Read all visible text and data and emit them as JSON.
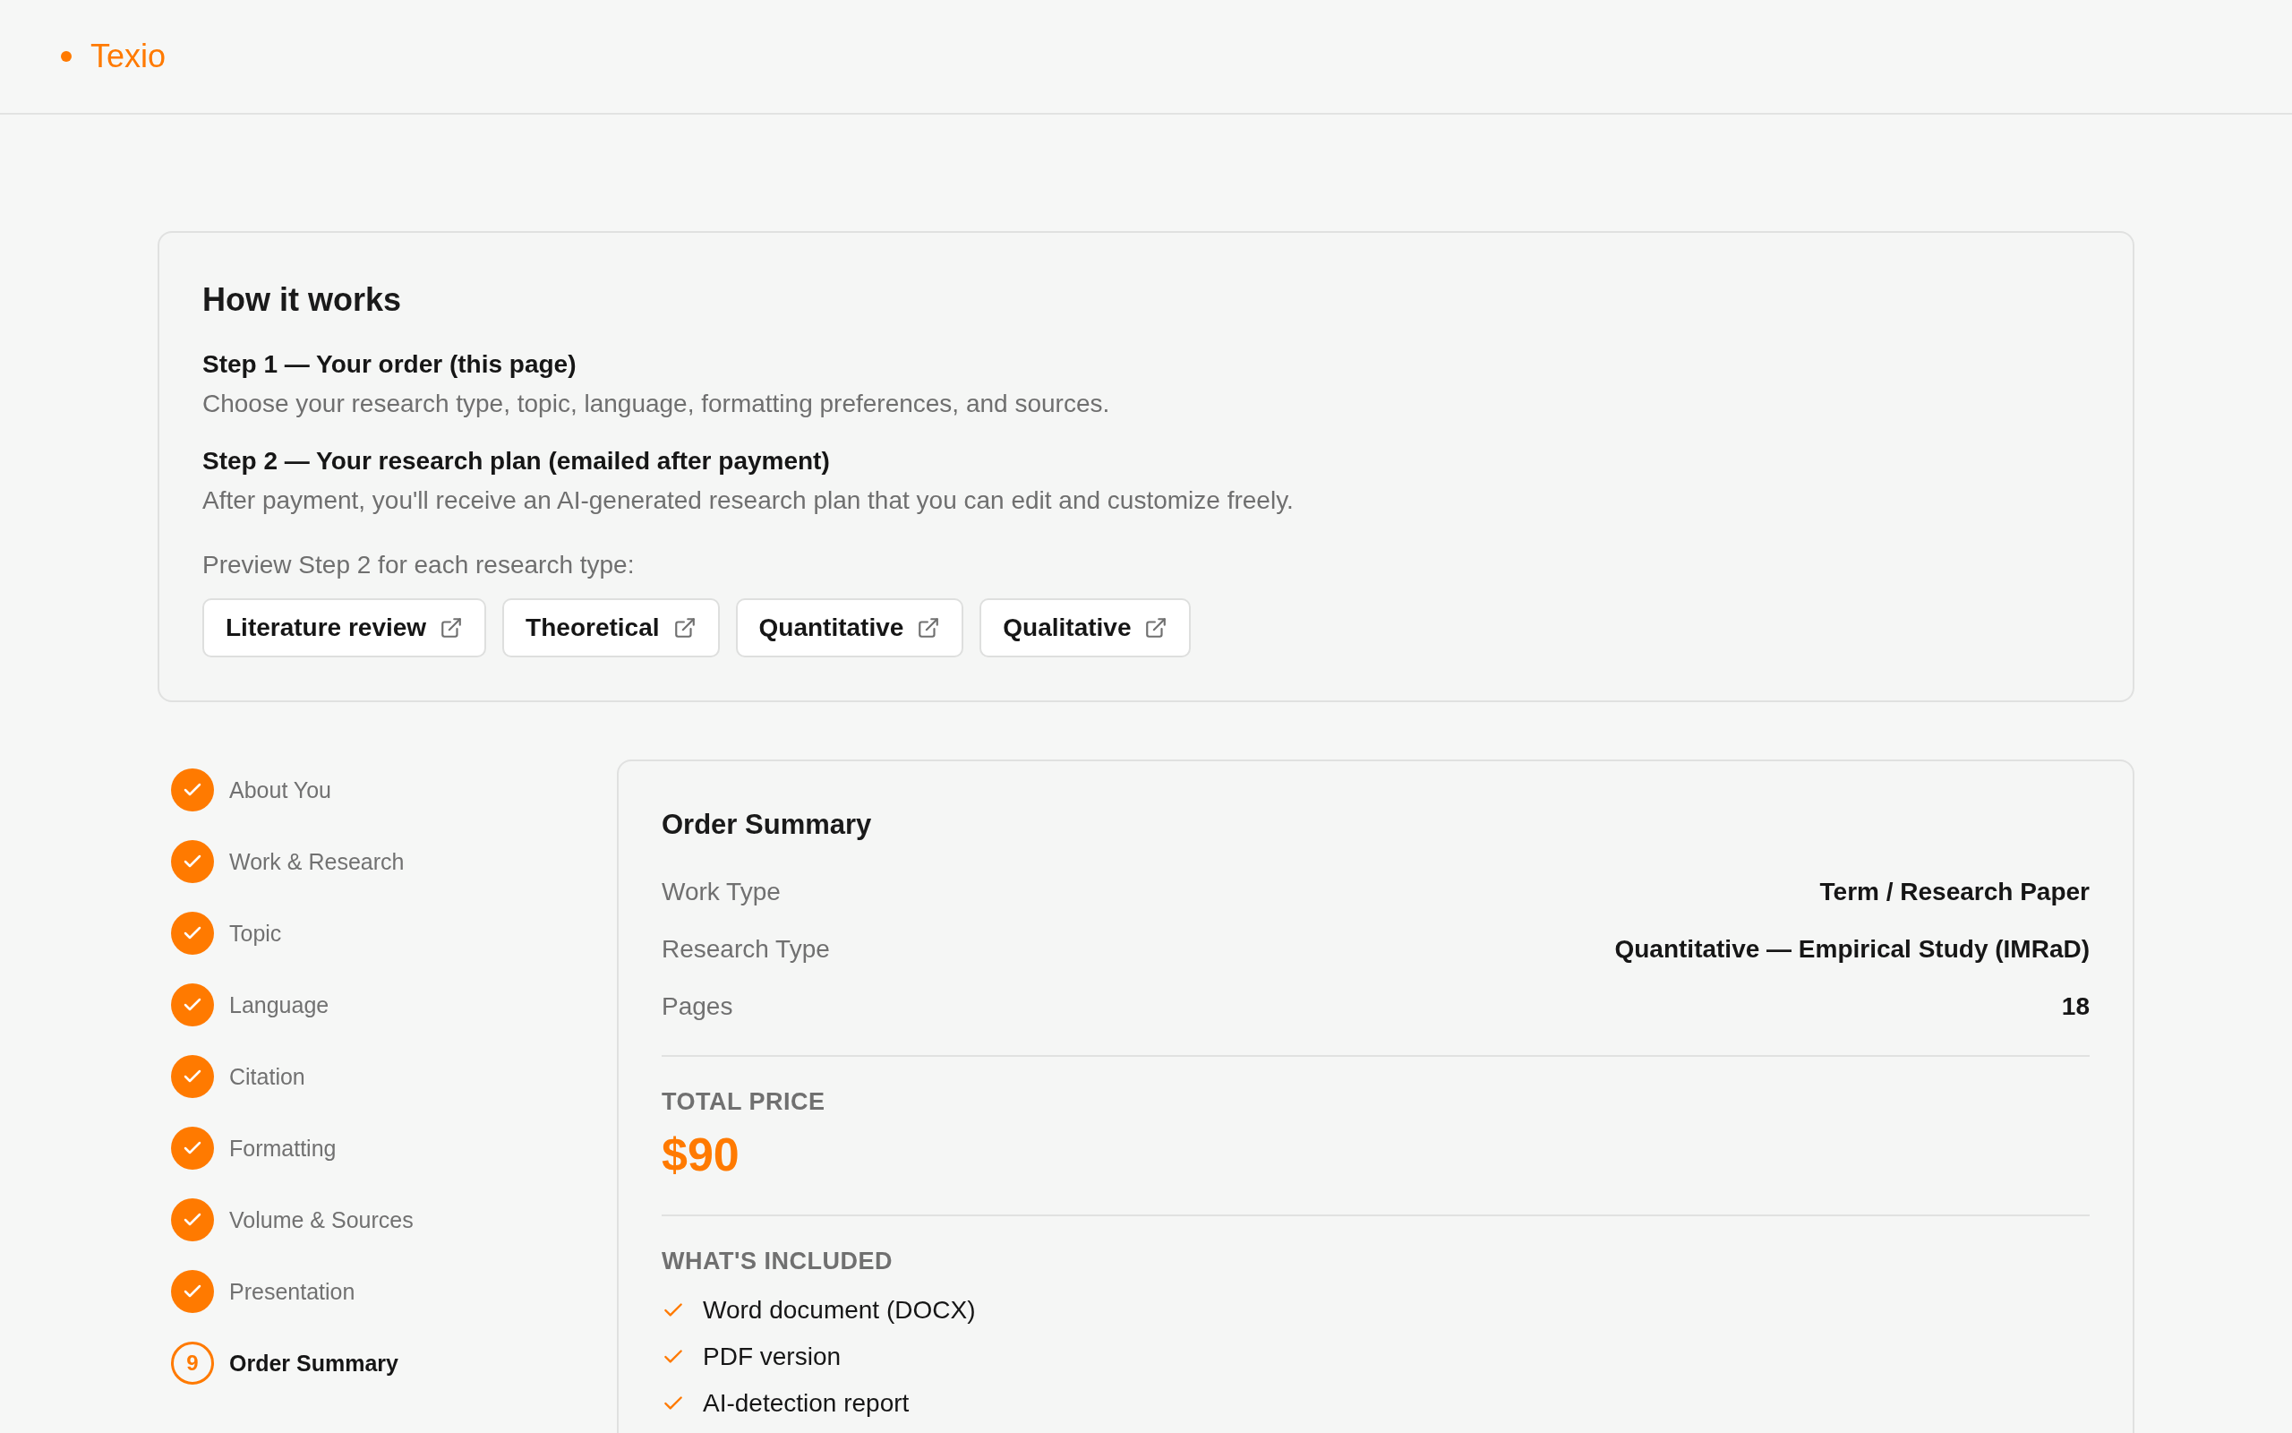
{
  "header": {
    "logo": "Texio"
  },
  "how_it_works": {
    "title": "How it works",
    "steps": [
      {
        "title": "Step 1 — Your order (this page)",
        "description": "Choose your research type, topic, language, formatting preferences, and sources."
      },
      {
        "title": "Step 2 — Your research plan (emailed after payment)",
        "description": "After payment, you'll receive an AI-generated research plan that you can edit and customize freely."
      }
    ],
    "preview_label": "Preview Step 2 for each research type:",
    "preview_links": [
      "Literature review",
      "Theoretical",
      "Quantitative",
      "Qualitative"
    ]
  },
  "steps_nav": [
    {
      "label": "About You",
      "completed": true,
      "selected": false
    },
    {
      "label": "Work & Research",
      "completed": true,
      "selected": false
    },
    {
      "label": "Topic",
      "completed": true,
      "selected": false
    },
    {
      "label": "Language",
      "completed": true,
      "selected": false
    },
    {
      "label": "Citation",
      "completed": true,
      "selected": false
    },
    {
      "label": "Formatting",
      "completed": true,
      "selected": false
    },
    {
      "label": "Volume & Sources",
      "completed": true,
      "selected": false
    },
    {
      "label": "Presentation",
      "completed": true,
      "selected": false
    },
    {
      "label": "Order Summary",
      "number": "9",
      "completed": false,
      "selected": true
    }
  ],
  "order_summary": {
    "title": "Order Summary",
    "details": [
      {
        "label": "Work Type",
        "value": "Term / Research Paper"
      },
      {
        "label": "Research Type",
        "value": "Quantitative — Empirical Study (IMRaD)"
      },
      {
        "label": "Pages",
        "value": "18"
      }
    ],
    "total_label": "TOTAL PRICE",
    "total": "$90",
    "included_label": "WHAT'S INCLUDED",
    "included": [
      "Word document (DOCX)",
      "PDF version",
      "AI-detection report"
    ]
  }
}
